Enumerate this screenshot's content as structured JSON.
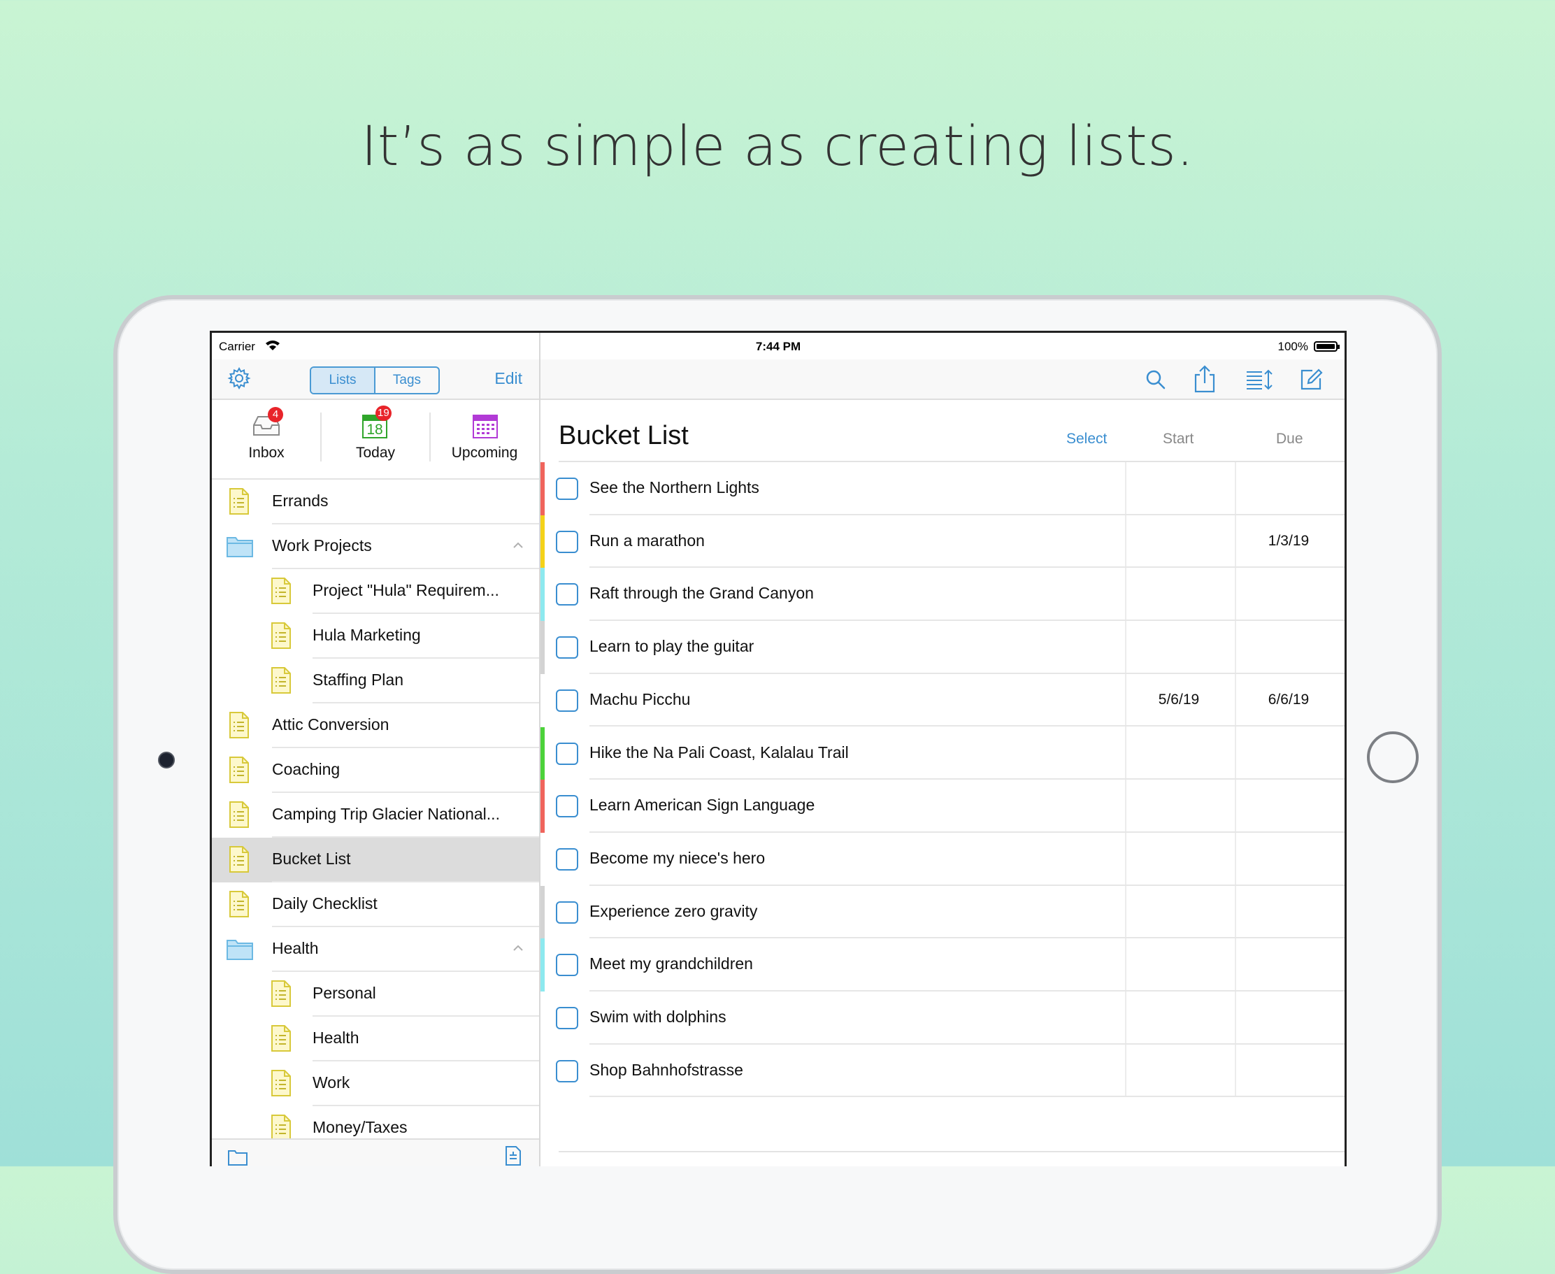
{
  "headline": "It’s as simple as creating lists.",
  "status_bar": {
    "carrier": "Carrier",
    "time": "7:44 PM",
    "battery": "100%"
  },
  "sidebar": {
    "segments": [
      {
        "label": "Lists",
        "active": true
      },
      {
        "label": "Tags",
        "active": false
      }
    ],
    "edit_label": "Edit",
    "smart_lists": [
      {
        "label": "Inbox",
        "badge": "4",
        "icon": "inbox-icon"
      },
      {
        "label": "Today",
        "badge": "19",
        "calendar_day": "18",
        "icon": "calendar-today-icon"
      },
      {
        "label": "Upcoming",
        "icon": "calendar-upcoming-icon"
      }
    ],
    "lists": [
      {
        "label": "Errands",
        "type": "list",
        "indent": 0
      },
      {
        "label": "Work Projects",
        "type": "folder",
        "indent": 0,
        "expanded": true
      },
      {
        "label": "Project \"Hula\" Requirem...",
        "type": "list",
        "indent": 1
      },
      {
        "label": "Hula Marketing",
        "type": "list",
        "indent": 1
      },
      {
        "label": "Staffing Plan",
        "type": "list",
        "indent": 1
      },
      {
        "label": "Attic Conversion",
        "type": "list",
        "indent": 0
      },
      {
        "label": "Coaching",
        "type": "list",
        "indent": 0
      },
      {
        "label": "Camping Trip Glacier National...",
        "type": "list",
        "indent": 0
      },
      {
        "label": "Bucket List",
        "type": "list",
        "indent": 0,
        "selected": true
      },
      {
        "label": "Daily Checklist",
        "type": "list",
        "indent": 0
      },
      {
        "label": "Health",
        "type": "folder",
        "indent": 0,
        "expanded": true
      },
      {
        "label": "Personal",
        "type": "list",
        "indent": 1
      },
      {
        "label": "Health",
        "type": "list",
        "indent": 1
      },
      {
        "label": "Work",
        "type": "list",
        "indent": 1
      },
      {
        "label": "Money/Taxes",
        "type": "list",
        "indent": 1
      }
    ]
  },
  "main": {
    "title": "Bucket List",
    "select_label": "Select",
    "start_label": "Start",
    "due_label": "Due",
    "tasks": [
      {
        "title": "See the Northern Lights",
        "start": "",
        "due": "",
        "tag_color": "#f0645c"
      },
      {
        "title": "Run a marathon",
        "start": "",
        "due": "1/3/19",
        "tag_color": "#f4d21a"
      },
      {
        "title": "Raft through the Grand Canyon",
        "start": "",
        "due": "",
        "tag_color": "#8de9ef"
      },
      {
        "title": "Learn to play the guitar",
        "start": "",
        "due": "",
        "tag_color": "#d3d3d3"
      },
      {
        "title": "Machu Picchu",
        "start": "5/6/19",
        "due": "6/6/19",
        "tag_color": ""
      },
      {
        "title": "Hike the Na Pali Coast, Kalalau Trail",
        "start": "",
        "due": "",
        "tag_color": "#4cd23a"
      },
      {
        "title": "Learn American Sign Language",
        "start": "",
        "due": "",
        "tag_color": "#f0645c"
      },
      {
        "title": "Become my niece's hero",
        "start": "",
        "due": "",
        "tag_color": ""
      },
      {
        "title": "Experience zero gravity",
        "start": "",
        "due": "",
        "tag_color": "#d3d3d3"
      },
      {
        "title": "Meet my grandchildren",
        "start": "",
        "due": "",
        "tag_color": "#8de9ef"
      },
      {
        "title": "Swim with dolphins",
        "start": "",
        "due": "",
        "tag_color": ""
      },
      {
        "title": "Shop Bahnhofstrasse",
        "start": "",
        "due": "",
        "tag_color": ""
      }
    ]
  },
  "colors": {
    "accent": "#3a8ed0",
    "badge": "#e8242a",
    "selected_row": "#dcdcdc"
  }
}
